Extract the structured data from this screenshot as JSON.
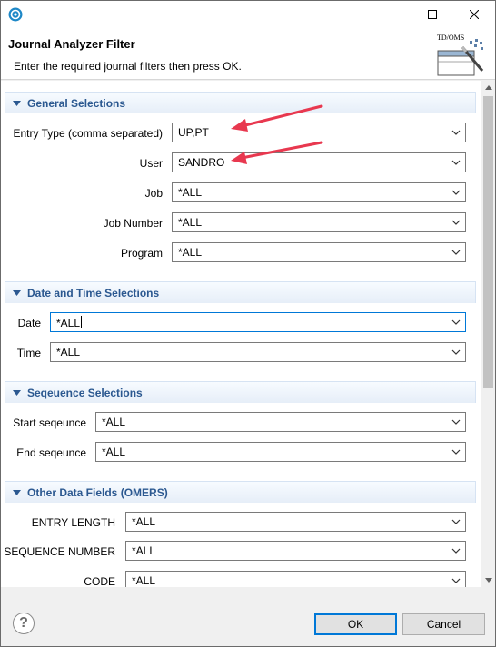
{
  "window": {
    "title": "Journal Analyzer Filter",
    "message": "Enter the required journal filters then press OK.",
    "logo_text": "TD/OMS"
  },
  "sections": {
    "general": {
      "title": "General Selections",
      "fields": [
        {
          "label": "Entry Type (comma separated)",
          "value": "UP,PT"
        },
        {
          "label": "User",
          "value": "SANDRO"
        },
        {
          "label": "Job",
          "value": "*ALL"
        },
        {
          "label": "Job Number",
          "value": "*ALL"
        },
        {
          "label": "Program",
          "value": "*ALL"
        }
      ]
    },
    "datetime": {
      "title": "Date and Time Selections",
      "fields": [
        {
          "label": "Date",
          "value": "*ALL"
        },
        {
          "label": "Time",
          "value": "*ALL"
        }
      ]
    },
    "sequence": {
      "title": "Seqeuence Selections",
      "fields": [
        {
          "label": "Start seqeunce",
          "value": "*ALL"
        },
        {
          "label": "End seqeunce",
          "value": "*ALL"
        }
      ]
    },
    "other": {
      "title": "Other Data Fields (OMERS)",
      "fields": [
        {
          "label": "ENTRY LENGTH",
          "value": "*ALL"
        },
        {
          "label": "SEQUENCE NUMBER",
          "value": "*ALL"
        },
        {
          "label": "CODE",
          "value": "*ALL"
        }
      ]
    }
  },
  "buttons": {
    "help": "?",
    "ok": "OK",
    "cancel": "Cancel"
  },
  "colors": {
    "section_title": "#2b5890",
    "annotation_arrow": "#e8384f",
    "focus": "#0078d7"
  },
  "icons": [
    "app-icon",
    "minimize-icon",
    "maximize-icon",
    "close-icon",
    "collapse-triangle-icon",
    "dropdown-chevron-icon",
    "help-icon",
    "filter-wand-icon"
  ]
}
